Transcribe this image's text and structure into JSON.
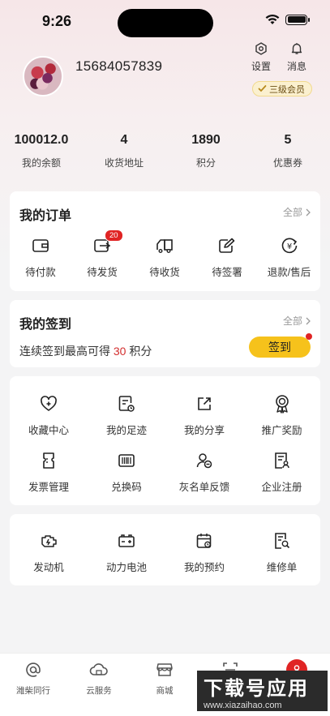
{
  "status_bar": {
    "time": "9:26"
  },
  "profile": {
    "phone": "15684057839",
    "vip_label": "三级会员"
  },
  "top_actions": {
    "settings_label": "设置",
    "messages_label": "消息"
  },
  "stats": [
    {
      "value": "100012.0",
      "label": "我的余额"
    },
    {
      "value": "4",
      "label": "收货地址"
    },
    {
      "value": "1890",
      "label": "积分"
    },
    {
      "value": "5",
      "label": "优惠券"
    }
  ],
  "orders": {
    "title": "我的订单",
    "more": "全部",
    "items": [
      {
        "label": "待付款",
        "icon": "wallet-icon"
      },
      {
        "label": "待发货",
        "icon": "box-out-icon",
        "badge": "20"
      },
      {
        "label": "待收货",
        "icon": "truck-icon"
      },
      {
        "label": "待签署",
        "icon": "sign-icon"
      },
      {
        "label": "退款/售后",
        "icon": "refund-icon"
      }
    ]
  },
  "signin": {
    "title": "我的签到",
    "more": "全部",
    "text_prefix": "连续签到最高可得",
    "points": "30",
    "text_suffix": "积分",
    "button": "签到"
  },
  "services": [
    {
      "label": "收藏中心",
      "icon": "heart-plus-icon"
    },
    {
      "label": "我的足迹",
      "icon": "footprint-icon"
    },
    {
      "label": "我的分享",
      "icon": "share-icon"
    },
    {
      "label": "推广奖励",
      "icon": "award-icon"
    },
    {
      "label": "发票管理",
      "icon": "invoice-icon"
    },
    {
      "label": "兑换码",
      "icon": "barcode-icon"
    },
    {
      "label": "灰名单反馈",
      "icon": "user-minus-icon"
    },
    {
      "label": "企业注册",
      "icon": "company-register-icon"
    }
  ],
  "vehicle": [
    {
      "label": "发动机",
      "icon": "engine-icon"
    },
    {
      "label": "动力电池",
      "icon": "battery-icon"
    },
    {
      "label": "我的预约",
      "icon": "calendar-icon"
    },
    {
      "label": "维修单",
      "icon": "repair-order-icon"
    }
  ],
  "tabs": [
    {
      "label": "潍柴同行",
      "icon": "at-icon"
    },
    {
      "label": "云服务",
      "icon": "cloud-icon"
    },
    {
      "label": "商城",
      "icon": "store-icon"
    },
    {
      "label": "",
      "icon": "scan-icon"
    },
    {
      "label": "",
      "icon": "me-icon"
    }
  ],
  "watermark": {
    "big": "下载号应用",
    "small": "www.xiazaihao.com"
  },
  "colors": {
    "accent_red": "#e02424",
    "signin_yellow": "#f6c21b"
  }
}
